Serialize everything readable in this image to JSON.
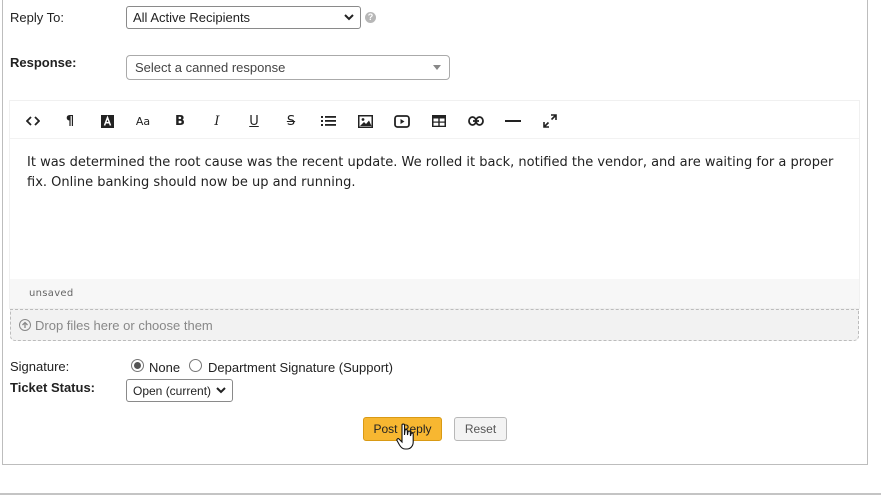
{
  "reply_to": {
    "label": "Reply To:",
    "value": "All Active Recipients",
    "help_icon": "?"
  },
  "response": {
    "label": "Response:",
    "placeholder": "Select a canned response"
  },
  "toolbar": {
    "buttons": [
      {
        "name": "code-view",
        "glyph": "<>"
      },
      {
        "name": "paragraph",
        "glyph": "¶"
      },
      {
        "name": "font-color",
        "glyph": "A"
      },
      {
        "name": "font-size",
        "glyph": "Aa"
      },
      {
        "name": "bold",
        "glyph": "B"
      },
      {
        "name": "italic",
        "glyph": "I"
      },
      {
        "name": "underline",
        "glyph": "U"
      },
      {
        "name": "strikethrough",
        "glyph": "S"
      },
      {
        "name": "list",
        "glyph": ""
      },
      {
        "name": "image",
        "glyph": ""
      },
      {
        "name": "video",
        "glyph": ""
      },
      {
        "name": "table",
        "glyph": ""
      },
      {
        "name": "link",
        "glyph": ""
      },
      {
        "name": "horizontal-rule",
        "glyph": ""
      },
      {
        "name": "fullscreen",
        "glyph": ""
      }
    ]
  },
  "editor": {
    "body": "It was determined the root cause was the recent update. We rolled it back, notified the vendor, and are waiting for a proper fix. Online banking should now be up and running.",
    "save_status": "unsaved"
  },
  "dropzone": {
    "text": "Drop files here or choose them"
  },
  "signature": {
    "label": "Signature:",
    "options": [
      {
        "label": "None",
        "checked": true
      },
      {
        "label": "Department Signature (Support)",
        "checked": false
      }
    ]
  },
  "ticket_status": {
    "label": "Ticket Status:",
    "value": "Open (current)"
  },
  "actions": {
    "post_reply": "Post Reply",
    "reset": "Reset"
  },
  "colors": {
    "post_button": "#f7b731",
    "accent_border": "#d99a14"
  }
}
